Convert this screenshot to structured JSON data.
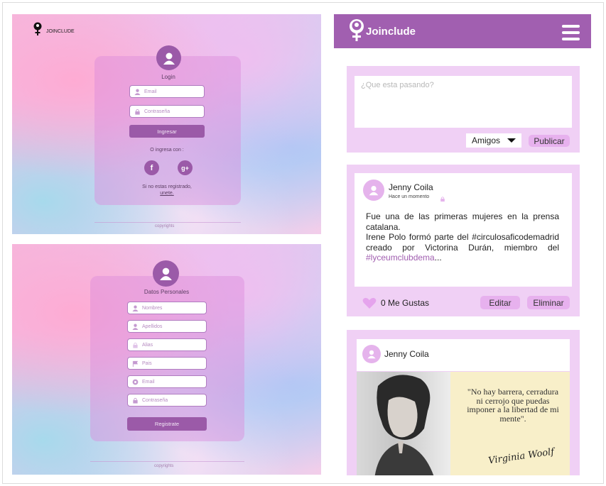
{
  "login": {
    "brand": "JOINCLUDE",
    "title": "Login",
    "email_placeholder": "Email",
    "password_placeholder": "Contraseña",
    "submit": "Ingresar",
    "alt_login": "O ingresa con :",
    "register_prompt": "Si no estas registrado,",
    "register_link": "unete.",
    "copyright": "copyrights"
  },
  "register": {
    "title": "Datos Personales",
    "fields": [
      "Nombres",
      "Apellidos",
      "Alias",
      "Pais",
      "Email",
      "Contraseña"
    ],
    "submit": "Registrate",
    "copyright": "copyrights"
  },
  "feed": {
    "brand": "Joinclude",
    "composer": {
      "placeholder": "¿Que esta pasando?",
      "audience": "Amigos",
      "publish": "Publicar"
    },
    "post1": {
      "author": "Jenny Coila",
      "time": "Hace un momento",
      "line1": "Fue una de las primeras mujeres en la prensa catalana.",
      "line2a": "Irene Polo formó parte del #circulosaficodemadrid creado por Victorina Durán, miembro del ",
      "hashtag": "#lyceumclubdema",
      "ellipsis": "...",
      "likes": "0 Me Gustas",
      "edit": "Editar",
      "delete": "Eliminar"
    },
    "post2": {
      "author": "Jenny Coila",
      "quote": "\"No hay barrera, cerradura ni cerrojo que puedas imponer a la libertad de mi mente\".",
      "signature": "Virginia Woolf"
    }
  },
  "colors": {
    "accent": "#a15fb0",
    "accent_dark": "#9b5aa8",
    "pill": "#e7b1ee",
    "block": "#f0d0f5"
  }
}
